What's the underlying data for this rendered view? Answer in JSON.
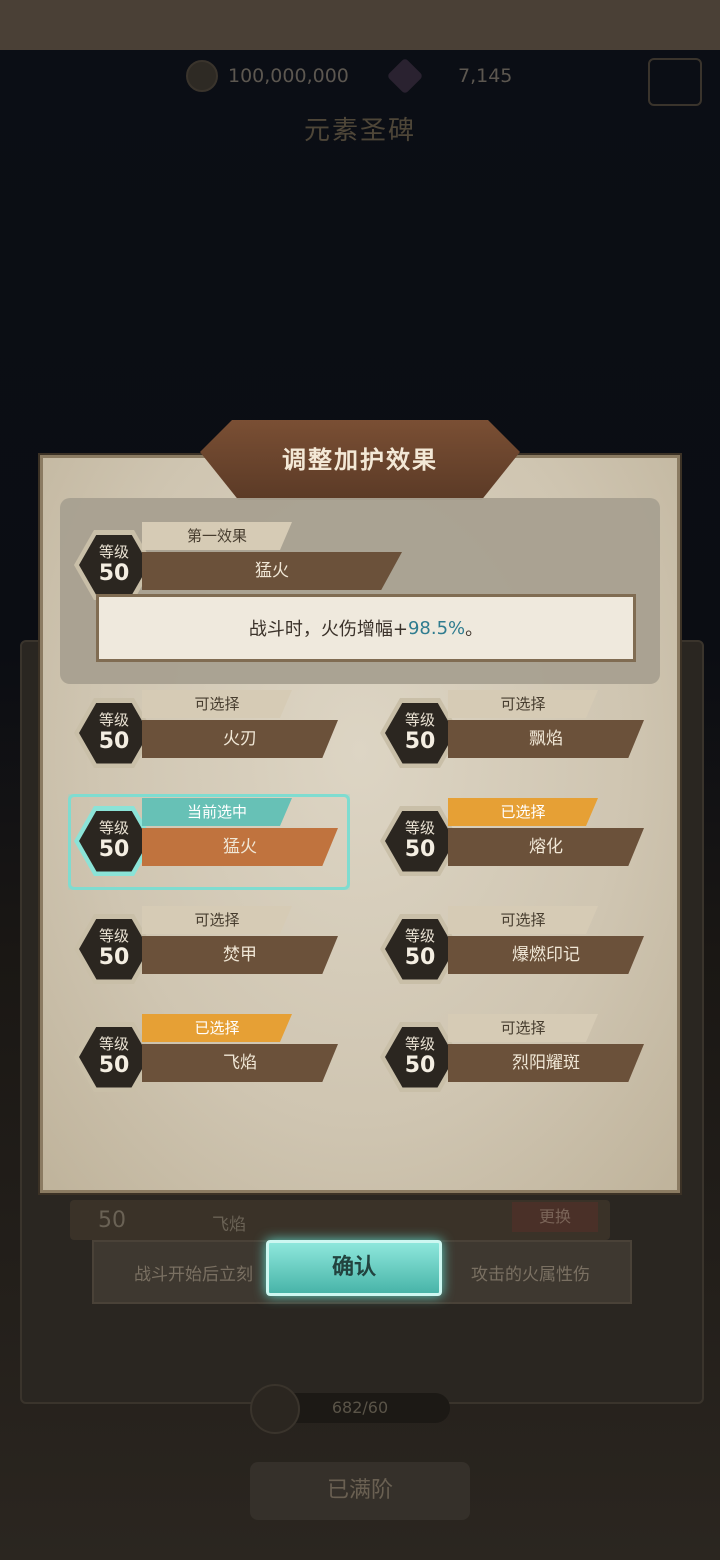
{
  "resources": {
    "gold": "100,000,000",
    "gems": "7,145"
  },
  "background": {
    "title": "元素圣碑",
    "row_level": "50",
    "row_name": "飞焰",
    "change_label": "更换",
    "desc_left": "战斗开始后立刻",
    "desc_right": "攻击的火属性伤",
    "progress": "682/60",
    "max_label": "已满阶"
  },
  "dialog": {
    "title": "调整加护效果",
    "primary": {
      "level_label": "等级",
      "level": "50",
      "tag": "第一效果",
      "name": "猛火",
      "desc_prefix": "战斗时，火伤增幅+",
      "desc_value": "98.5%",
      "desc_suffix": "。"
    },
    "options": [
      {
        "level_label": "等级",
        "level": "50",
        "tag": "可选择",
        "name": "火刃",
        "state": "available"
      },
      {
        "level_label": "等级",
        "level": "50",
        "tag": "可选择",
        "name": "飘焰",
        "state": "available"
      },
      {
        "level_label": "等级",
        "level": "50",
        "tag": "当前选中",
        "name": "猛火",
        "state": "current"
      },
      {
        "level_label": "等级",
        "level": "50",
        "tag": "已选择",
        "name": "熔化",
        "state": "selected"
      },
      {
        "level_label": "等级",
        "level": "50",
        "tag": "可选择",
        "name": "焚甲",
        "state": "available"
      },
      {
        "level_label": "等级",
        "level": "50",
        "tag": "可选择",
        "name": "爆燃印记",
        "state": "available"
      },
      {
        "level_label": "等级",
        "level": "50",
        "tag": "已选择",
        "name": "飞焰",
        "state": "selected"
      },
      {
        "level_label": "等级",
        "level": "50",
        "tag": "可选择",
        "name": "烈阳耀斑",
        "state": "available"
      }
    ],
    "confirm_label": "确认"
  },
  "colors": {
    "accent_teal": "#67c1b6",
    "selected_orange": "#e6a035",
    "namebar_brown": "#6b513a"
  }
}
